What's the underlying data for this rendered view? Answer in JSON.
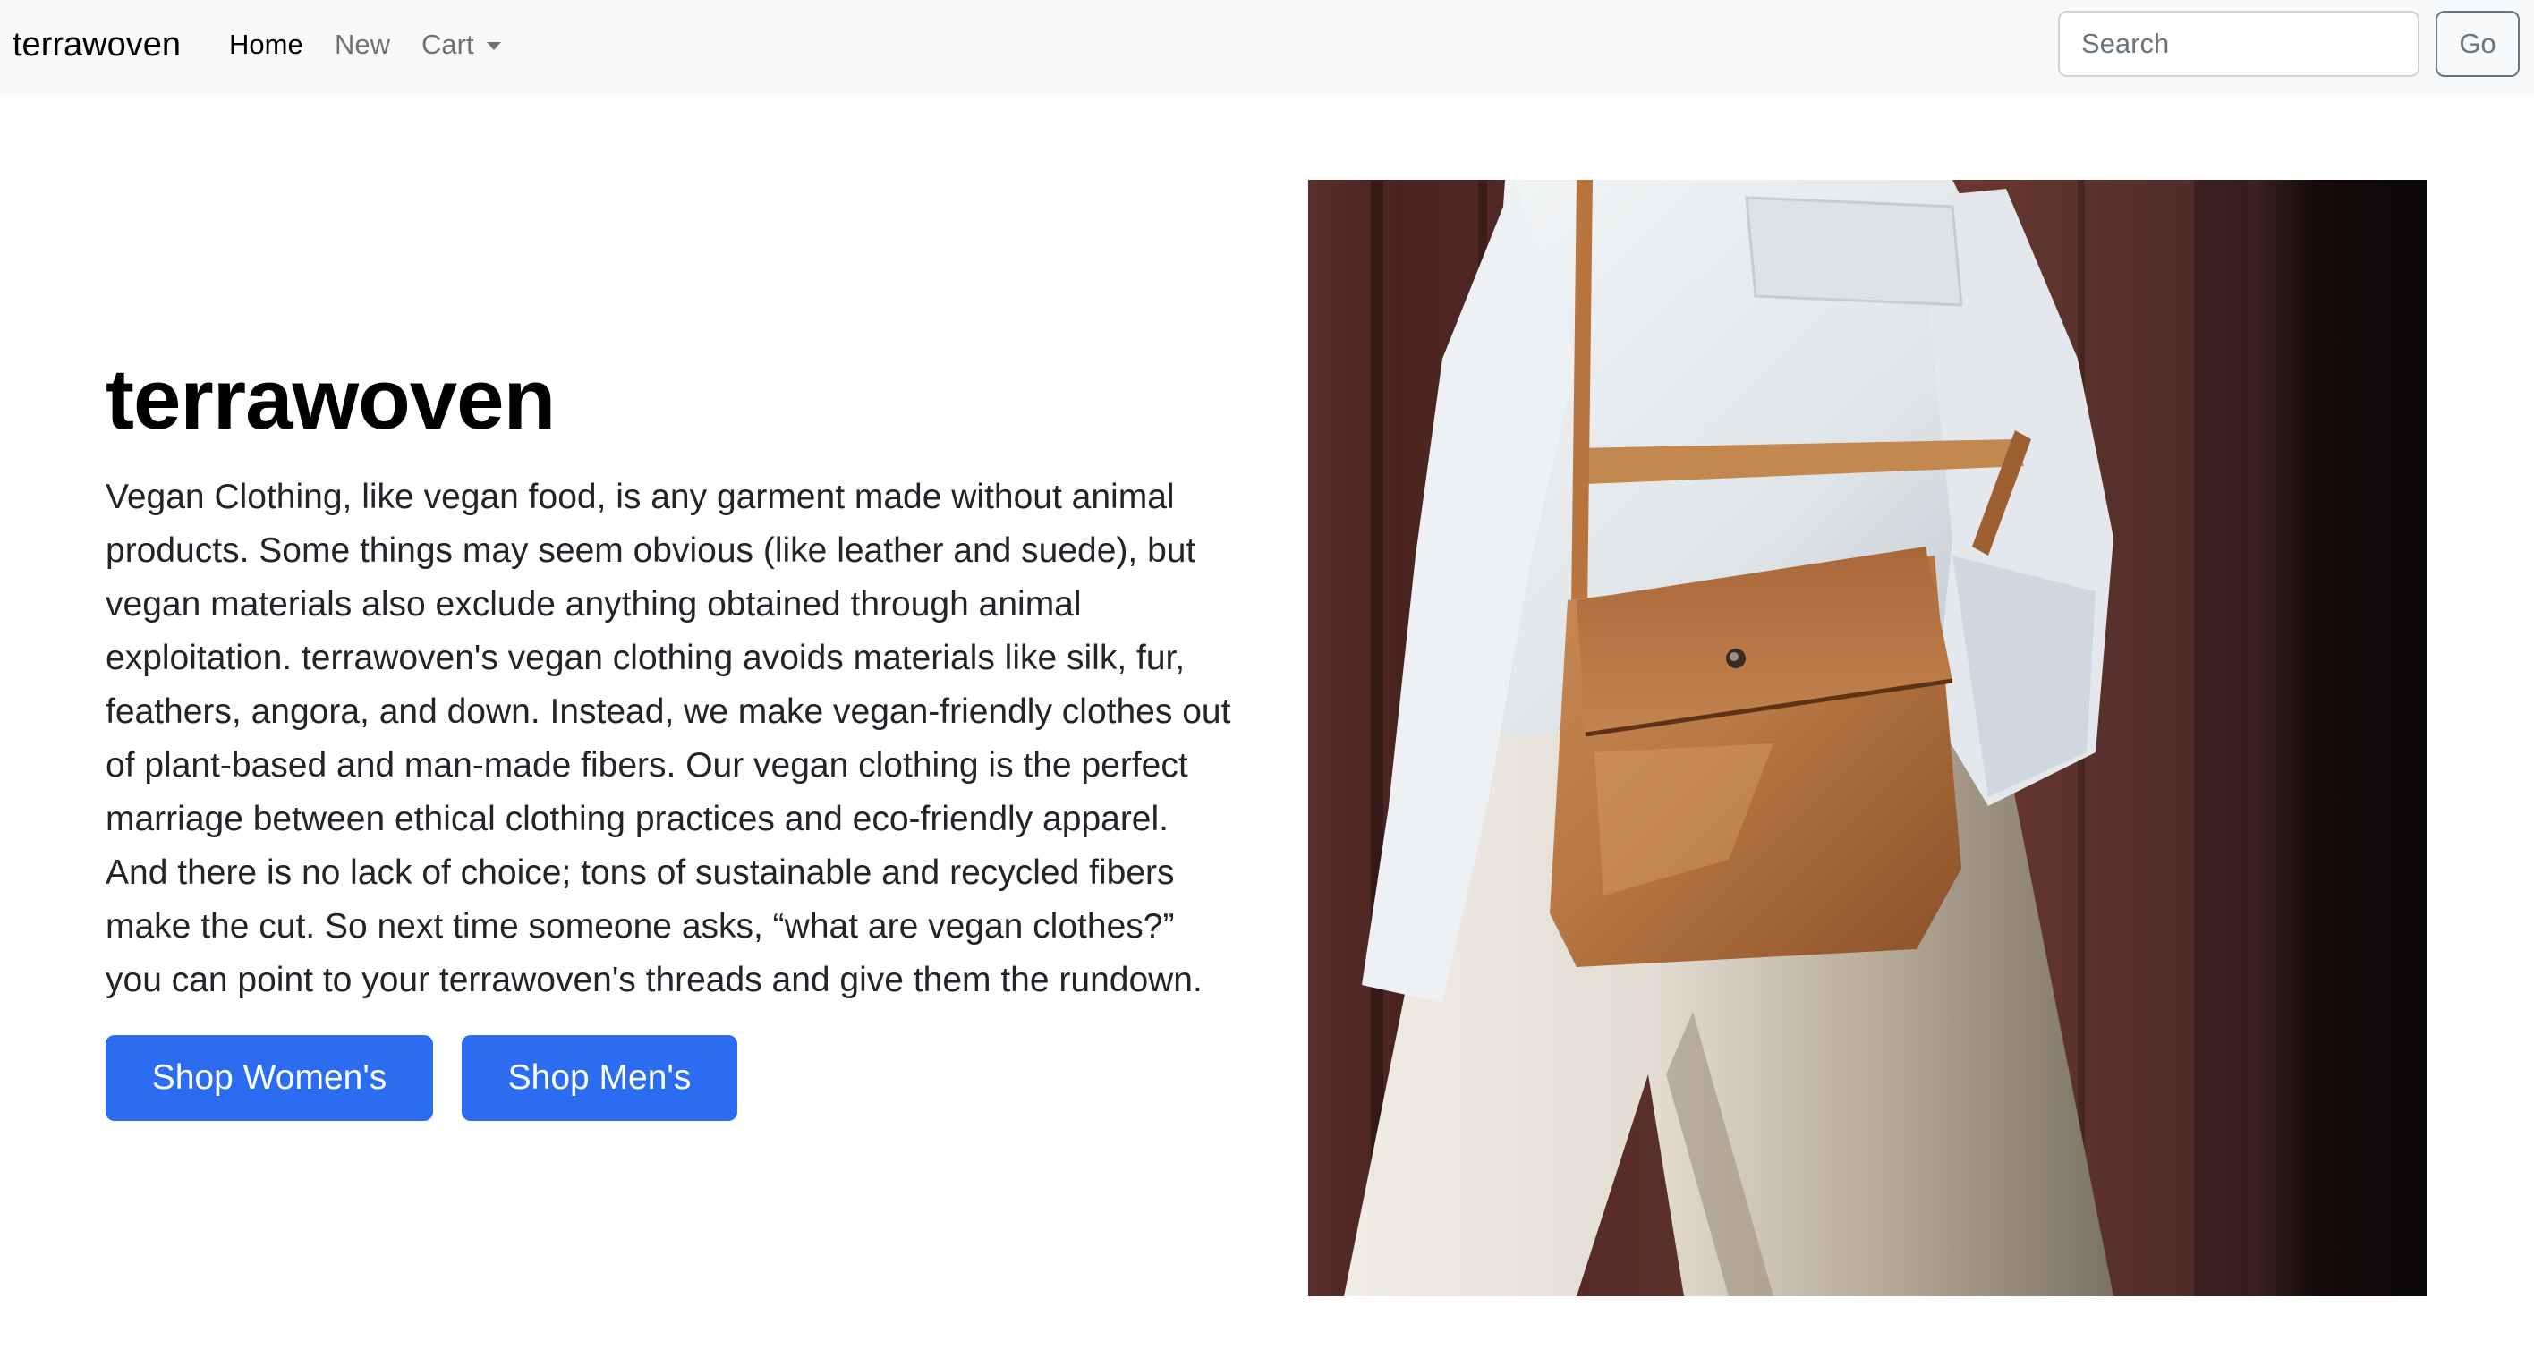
{
  "navbar": {
    "brand": "terrawoven",
    "links": [
      {
        "label": "Home",
        "active": true
      },
      {
        "label": "New",
        "active": false
      },
      {
        "label": "Cart",
        "active": false,
        "dropdown": true
      }
    ],
    "search": {
      "placeholder": "Search",
      "value": ""
    },
    "go_label": "Go"
  },
  "hero": {
    "title": "terrawoven",
    "description": "Vegan Clothing, like vegan food, is any garment made without animal products. Some things may seem obvious (like leather and suede), but vegan materials also exclude anything obtained through animal exploitation. terrawoven's vegan clothing avoids materials like silk, fur, feathers, angora, and down. Instead, we make vegan-friendly clothes out of plant-based and man-made fibers. Our vegan clothing is the perfect marriage between ethical clothing practices and eco-friendly apparel. And there is no lack of choice; tons of sustainable and recycled fibers make the cut. So next time someone asks, “what are vegan clothes?” you can point to your terrawoven's threads and give them the rundown.",
    "buttons": {
      "women": "Shop Women's",
      "men": "Shop Men's"
    },
    "image_icon": "photo-person-with-leather-crossbody-bag"
  },
  "colors": {
    "navbar_bg": "#f8f9fa",
    "primary": "#2b6cf0",
    "go_border": "#6c757d"
  }
}
